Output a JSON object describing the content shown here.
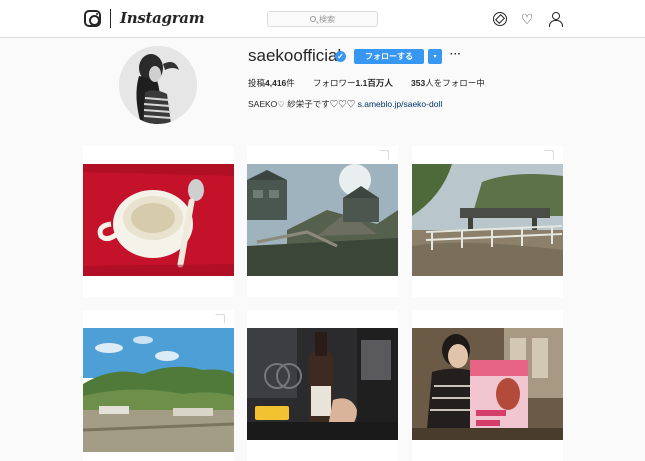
{
  "header": {
    "wordmark": "Instagram",
    "search_placeholder": "検索",
    "icons": [
      "instagram-logo-icon",
      "compass-icon",
      "heart-icon",
      "person-icon"
    ]
  },
  "profile": {
    "username": "saekoofficial",
    "verified": true,
    "follow_label": "フォローする",
    "dropdown_glyph": "▾",
    "more_glyph": "···",
    "stats": {
      "posts_label": "投稿",
      "posts_value": "4,416",
      "posts_unit": "件",
      "followers_label": "フォロワー",
      "followers_value": "1.1",
      "followers_unit": "百万人",
      "following_value": "353",
      "following_label": "人をフォロー中"
    },
    "bio_text": "SAEKO♡ 紗栄子です♡♡♡ ",
    "bio_link": "s.ameblo.jp/saeko-doll"
  },
  "posts": [
    {
      "name": "soup-bowl"
    },
    {
      "name": "village-rooftops"
    },
    {
      "name": "riverbank-bridge"
    },
    {
      "name": "hillside-landscape"
    },
    {
      "name": "bottle-in-hand"
    },
    {
      "name": "magazine-cafe"
    }
  ],
  "colors": {
    "accent": "#3897f0",
    "text": "#262626",
    "link": "#003569",
    "background": "#fafafa",
    "border": "#dbdbdb"
  }
}
